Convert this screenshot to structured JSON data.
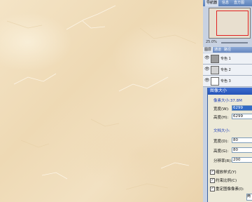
{
  "navigator": {
    "tabs": [
      "导航器",
      "信息",
      "直方图"
    ],
    "zoom_label": "25.0%"
  },
  "layers": {
    "tabs": [
      "图层",
      "通道",
      "路径"
    ],
    "items": [
      {
        "name": "专色 1"
      },
      {
        "name": "专色 2"
      },
      {
        "name": "专色 3"
      }
    ]
  },
  "image_size_dialog": {
    "title": "图像大小",
    "pixel_dimensions_label": "像素大小:37.8M",
    "width_label": "宽度(W):",
    "width_value": "6299",
    "height_label": "高度(H):",
    "height_value": "6299",
    "document_size_label": "文档大小:",
    "doc_width_label": "宽度(D):",
    "doc_width_value": "80",
    "doc_height_label": "高度(G):",
    "doc_height_value": "80",
    "resolution_label": "分辨率(R):",
    "resolution_value": "200",
    "scale_styles_label": "缩放样式(Y)",
    "constrain_label": "约束比例(C)",
    "resample_label": "重定图像像素(I):",
    "resample_value": "两"
  },
  "colors": {
    "marble": "#f0ddbb",
    "selection": "#316ac5",
    "dialog_title": "#2555b8"
  }
}
